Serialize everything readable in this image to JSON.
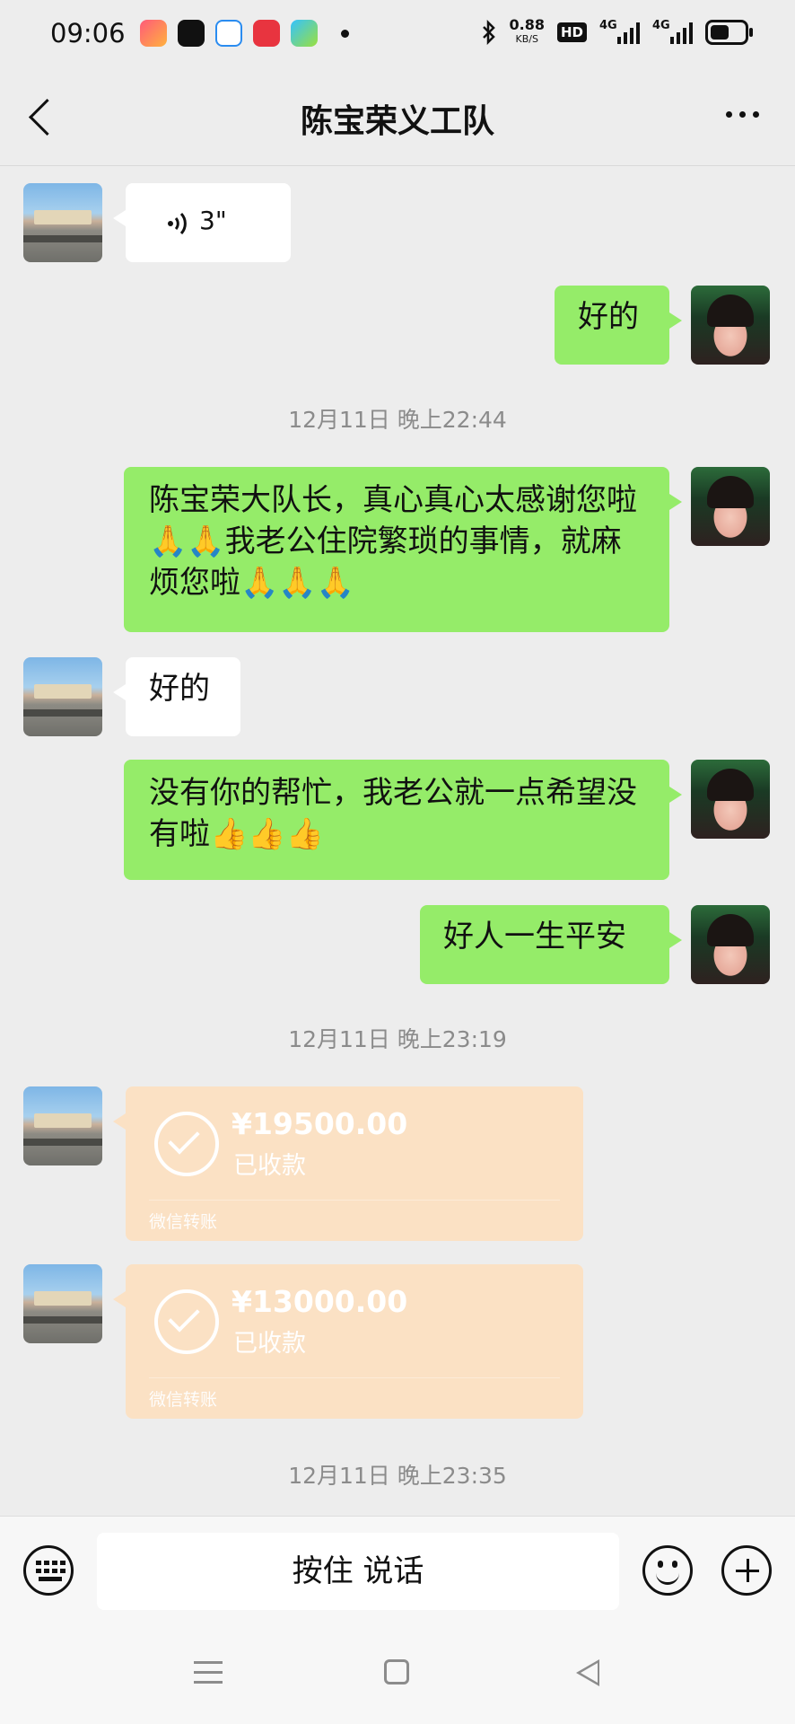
{
  "status_bar": {
    "time": "09:06",
    "net_speed": "0.88",
    "net_unit": "KB/S",
    "hd_badge": "HD",
    "network_1": "4G",
    "network_2": "4G",
    "app_icons": [
      "video-app-icon",
      "tiktok-icon",
      "browser-icon",
      "shopping-app-icon",
      "tencent-video-icon"
    ]
  },
  "header": {
    "back_icon": "chevron-left-icon",
    "title": "陈宝荣义工队",
    "more_icon": "more-dots-icon"
  },
  "messages": {
    "voice_duration": "3\"",
    "msg_1": "好的",
    "timestamp_1": "12月11日 晚上22:44",
    "msg_2": "陈宝荣大队长，真心真心太感谢您啦🙏🙏我老公住院繁琐的事情，就麻烦您啦🙏🙏🙏",
    "msg_3": "好的",
    "msg_4": "没有你的帮忙，我老公就一点希望没有啦👍👍👍",
    "msg_5": "好人一生平安",
    "timestamp_2": "12月11日 晚上23:19",
    "transfer_1": {
      "amount": "¥19500.00",
      "status": "已收款",
      "label": "微信转账"
    },
    "transfer_2": {
      "amount": "¥13000.00",
      "status": "已收款",
      "label": "微信转账"
    },
    "timestamp_3": "12月11日 晚上23:35"
  },
  "input_bar": {
    "hold_to_talk": "按住 说话",
    "keyboard_icon": "keyboard-icon",
    "emoji_icon": "emoji-icon",
    "plus_icon": "plus-icon"
  },
  "colors": {
    "bubble_sent": "#95ec69",
    "bubble_received": "#ffffff",
    "transfer_received": "#fbe1c4",
    "background": "#ededed"
  }
}
